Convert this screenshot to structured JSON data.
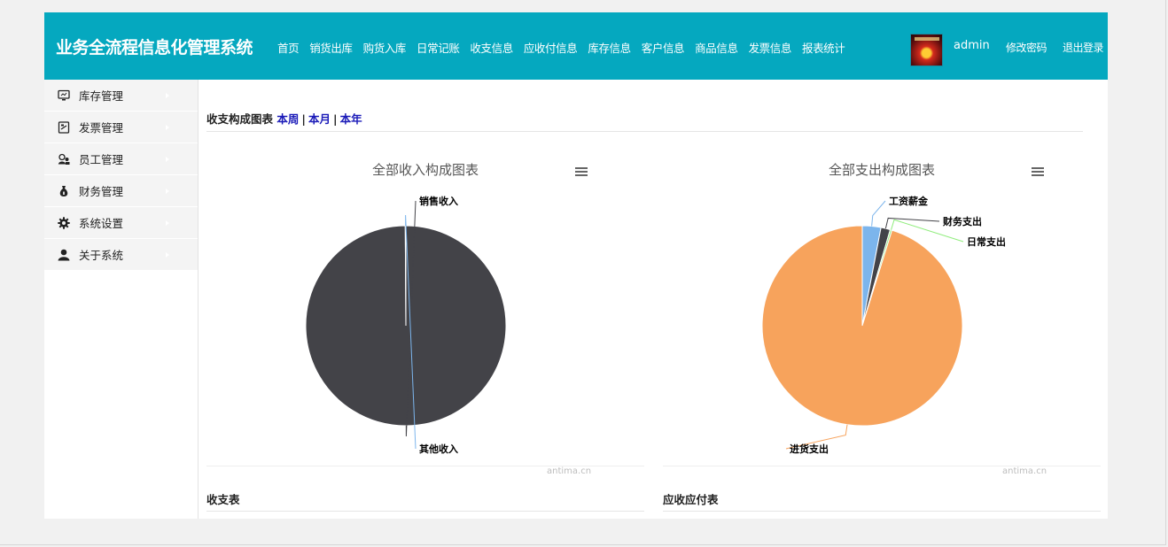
{
  "header": {
    "brand": "业务全流程信息化管理系统",
    "nav": [
      "首页",
      "销货出库",
      "购货入库",
      "日常记账",
      "收支信息",
      "应收付信息",
      "库存信息",
      "客户信息",
      "商品信息",
      "发票信息",
      "报表统计"
    ],
    "username": "admin",
    "change_password": "修改密码",
    "logout": "退出登录"
  },
  "sidebar": {
    "items": [
      {
        "label": "库存管理",
        "icon": "monitor-icon"
      },
      {
        "label": "发票管理",
        "icon": "document-icon"
      },
      {
        "label": "员工管理",
        "icon": "users-icon"
      },
      {
        "label": "财务管理",
        "icon": "money-bag-icon"
      },
      {
        "label": "系统设置",
        "icon": "gear-icon"
      },
      {
        "label": "关于系统",
        "icon": "user-icon"
      }
    ]
  },
  "main": {
    "chart_section_title": "收支构成图表",
    "ranges": [
      "本周",
      "本月",
      "本年"
    ],
    "credit": "antima.cn",
    "income_table_title": "收支表",
    "receivable_table_title": "应收应付表"
  },
  "chart_data": [
    {
      "type": "pie",
      "title": "全部收入构成图表",
      "series": [
        {
          "name": "销售收入",
          "value": 99.9,
          "color": "#434348"
        },
        {
          "name": "其他收入",
          "value": 0.1,
          "color": "#7cb5ec"
        }
      ]
    },
    {
      "type": "pie",
      "title": "全部支出构成图表",
      "series": [
        {
          "name": "工资薪金",
          "value": 3.0,
          "color": "#7cb5ec"
        },
        {
          "name": "财务支出",
          "value": 1.5,
          "color": "#434348"
        },
        {
          "name": "日常支出",
          "value": 0.3,
          "color": "#90ed7d"
        },
        {
          "name": "进货支出",
          "value": 95.2,
          "color": "#f7a35c"
        }
      ]
    }
  ]
}
